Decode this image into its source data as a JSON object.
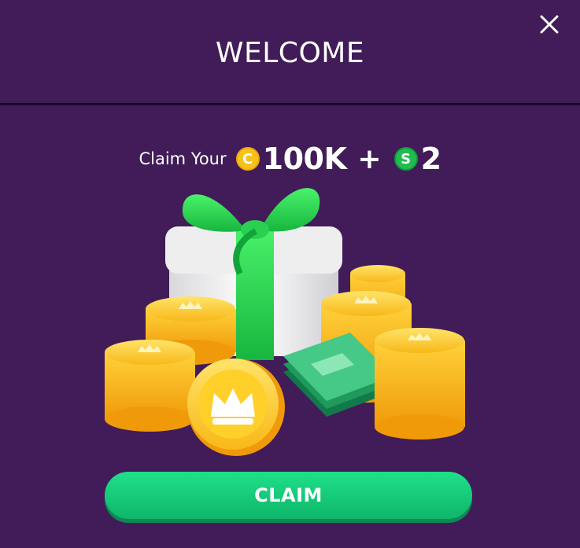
{
  "dialog": {
    "title": "WELCOME",
    "close_icon": "close-icon"
  },
  "offer": {
    "prefix": "Claim Your",
    "coin_icon_letter": "C",
    "coin_amount": "100K",
    "plus": "+",
    "cash_icon_letter": "S",
    "cash_amount": "2"
  },
  "claim_button": {
    "label": "CLAIM"
  },
  "colors": {
    "background": "#411c58",
    "coin": "#f7c21a",
    "cash_badge": "#1fbd4f",
    "button": "#17c877"
  }
}
